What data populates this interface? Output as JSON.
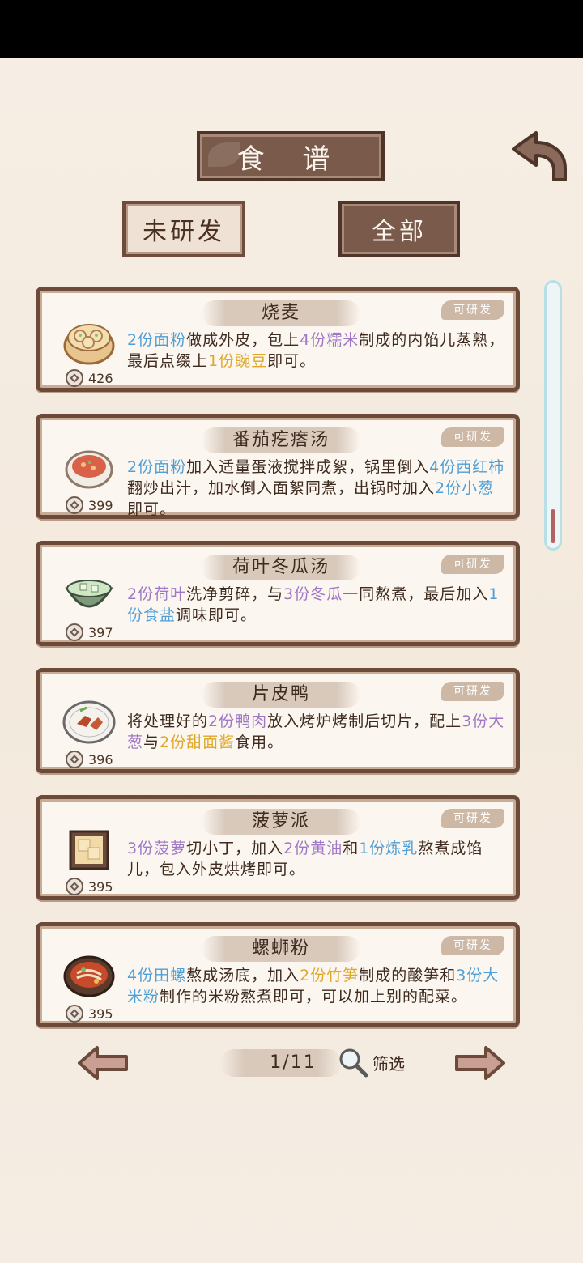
{
  "header": {
    "title": "食 谱"
  },
  "tabs": [
    {
      "label": "未研发",
      "active": false
    },
    {
      "label": "全部",
      "active": true
    }
  ],
  "colors": {
    "blue": "#4f9fd6",
    "purple": "#9f77c6",
    "yellow": "#e0a82a",
    "cyan": "#5ab8c8"
  },
  "recipes": [
    {
      "name": "烧麦",
      "badge": "可研发",
      "cost": "426",
      "icon": "shaomai-steamer-icon",
      "desc": [
        {
          "t": "2份面粉",
          "c": "#4f9fd6"
        },
        {
          "t": "做成外皮，包上"
        },
        {
          "t": "4份糯米",
          "c": "#9f77c6"
        },
        {
          "t": "制成的内馅儿蒸熟，最后点缀上"
        },
        {
          "t": "1份豌豆",
          "c": "#e0a82a"
        },
        {
          "t": "即可。"
        }
      ]
    },
    {
      "name": "番茄疙瘩汤",
      "badge": "可研发",
      "cost": "399",
      "icon": "tomato-soup-icon",
      "desc": [
        {
          "t": "2份面粉",
          "c": "#4f9fd6"
        },
        {
          "t": "加入适量蛋液搅拌成絮，锅里倒入"
        },
        {
          "t": "4份西红柿",
          "c": "#4f9fd6"
        },
        {
          "t": "翻炒出汁，加水倒入面絮同煮，出锅时加入"
        },
        {
          "t": "2份小葱",
          "c": "#4f9fd6"
        },
        {
          "t": "即可。"
        }
      ]
    },
    {
      "name": "荷叶冬瓜汤",
      "badge": "可研发",
      "cost": "397",
      "icon": "lotus-melon-soup-icon",
      "desc": [
        {
          "t": "2份荷叶",
          "c": "#9f77c6"
        },
        {
          "t": "洗净剪碎，与"
        },
        {
          "t": "3份冬瓜",
          "c": "#9f77c6"
        },
        {
          "t": "一同熬煮，最后加入"
        },
        {
          "t": "1份食盐",
          "c": "#4f9fd6"
        },
        {
          "t": "调味即可。"
        }
      ]
    },
    {
      "name": "片皮鸭",
      "badge": "可研发",
      "cost": "396",
      "icon": "roast-duck-icon",
      "desc": [
        {
          "t": "将处理好的"
        },
        {
          "t": "2份鸭肉",
          "c": "#9f77c6"
        },
        {
          "t": "放入烤炉烤制后切片，配上"
        },
        {
          "t": "3份大葱",
          "c": "#9f77c6"
        },
        {
          "t": "与"
        },
        {
          "t": "2份甜面酱",
          "c": "#e0a82a"
        },
        {
          "t": "食用。"
        }
      ]
    },
    {
      "name": "菠萝派",
      "badge": "可研发",
      "cost": "395",
      "icon": "pineapple-pie-icon",
      "desc": [
        {
          "t": "3份菠萝",
          "c": "#9f77c6"
        },
        {
          "t": "切小丁，加入"
        },
        {
          "t": "2份黄油",
          "c": "#9f77c6"
        },
        {
          "t": "和"
        },
        {
          "t": "1份炼乳",
          "c": "#4f9fd6"
        },
        {
          "t": "熬煮成馅儿，包入外皮烘烤即可。"
        }
      ]
    },
    {
      "name": "螺蛳粉",
      "badge": "可研发",
      "cost": "395",
      "icon": "snail-noodles-icon",
      "desc": [
        {
          "t": "4份田螺",
          "c": "#4f9fd6"
        },
        {
          "t": "熬成汤底，加入"
        },
        {
          "t": "2份竹笋",
          "c": "#e0a82a"
        },
        {
          "t": "制成的酸笋和"
        },
        {
          "t": "3份大米粉",
          "c": "#4f9fd6"
        },
        {
          "t": "制作的米粉熬煮即可，可以加上别的配菜。"
        }
      ]
    }
  ],
  "pager": {
    "page": "1/11",
    "filter_label": "筛选"
  }
}
